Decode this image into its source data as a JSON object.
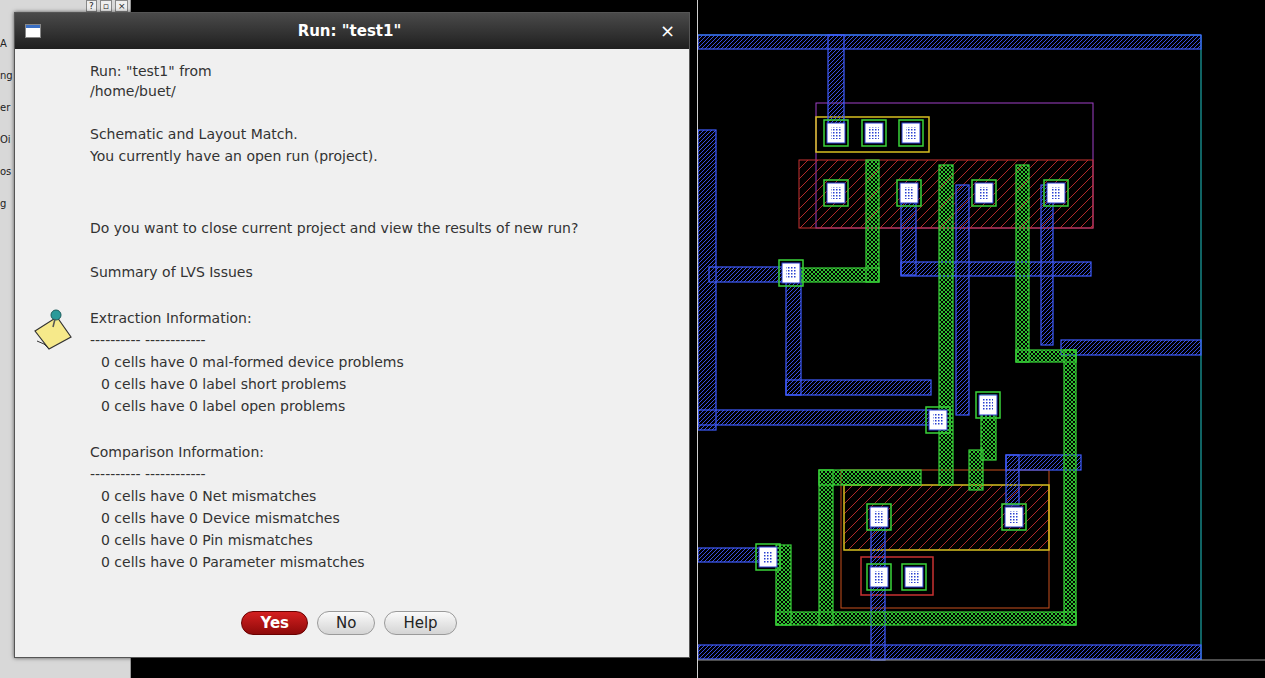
{
  "background_window": {
    "controls": [
      "?",
      "▫",
      "×"
    ],
    "fragments": [
      "A",
      "ng",
      "er",
      "Oi",
      "os",
      "g"
    ]
  },
  "dialog": {
    "title": "Run: \"test1\"",
    "close": "×",
    "header": [
      "Run: \"test1\"  from",
      "/home/buet/"
    ],
    "status": [
      "Schematic and Layout Match.",
      "You currently have an open run (project)."
    ],
    "question": "Do you want to close current project and view the results of new run?",
    "summary_title": "Summary of LVS Issues",
    "sections": [
      {
        "title": "Extraction Information:",
        "rule": "---------- ------------",
        "items": [
          "0 cells have 0 mal-formed device problems",
          "0 cells have 0 label short problems",
          "0 cells have 0 label open problems"
        ]
      },
      {
        "title": "Comparison Information:",
        "rule": "---------- ------------",
        "items": [
          "0 cells have 0 Net mismatches",
          "0 cells have 0 Device mismatches",
          "0 cells have 0 Pin mismatches",
          "0 cells have 0 Parameter mismatches"
        ]
      }
    ],
    "buttons": [
      {
        "label": "Yes",
        "selected": true
      },
      {
        "label": "No",
        "selected": false
      },
      {
        "label": "Help",
        "selected": false
      }
    ]
  }
}
